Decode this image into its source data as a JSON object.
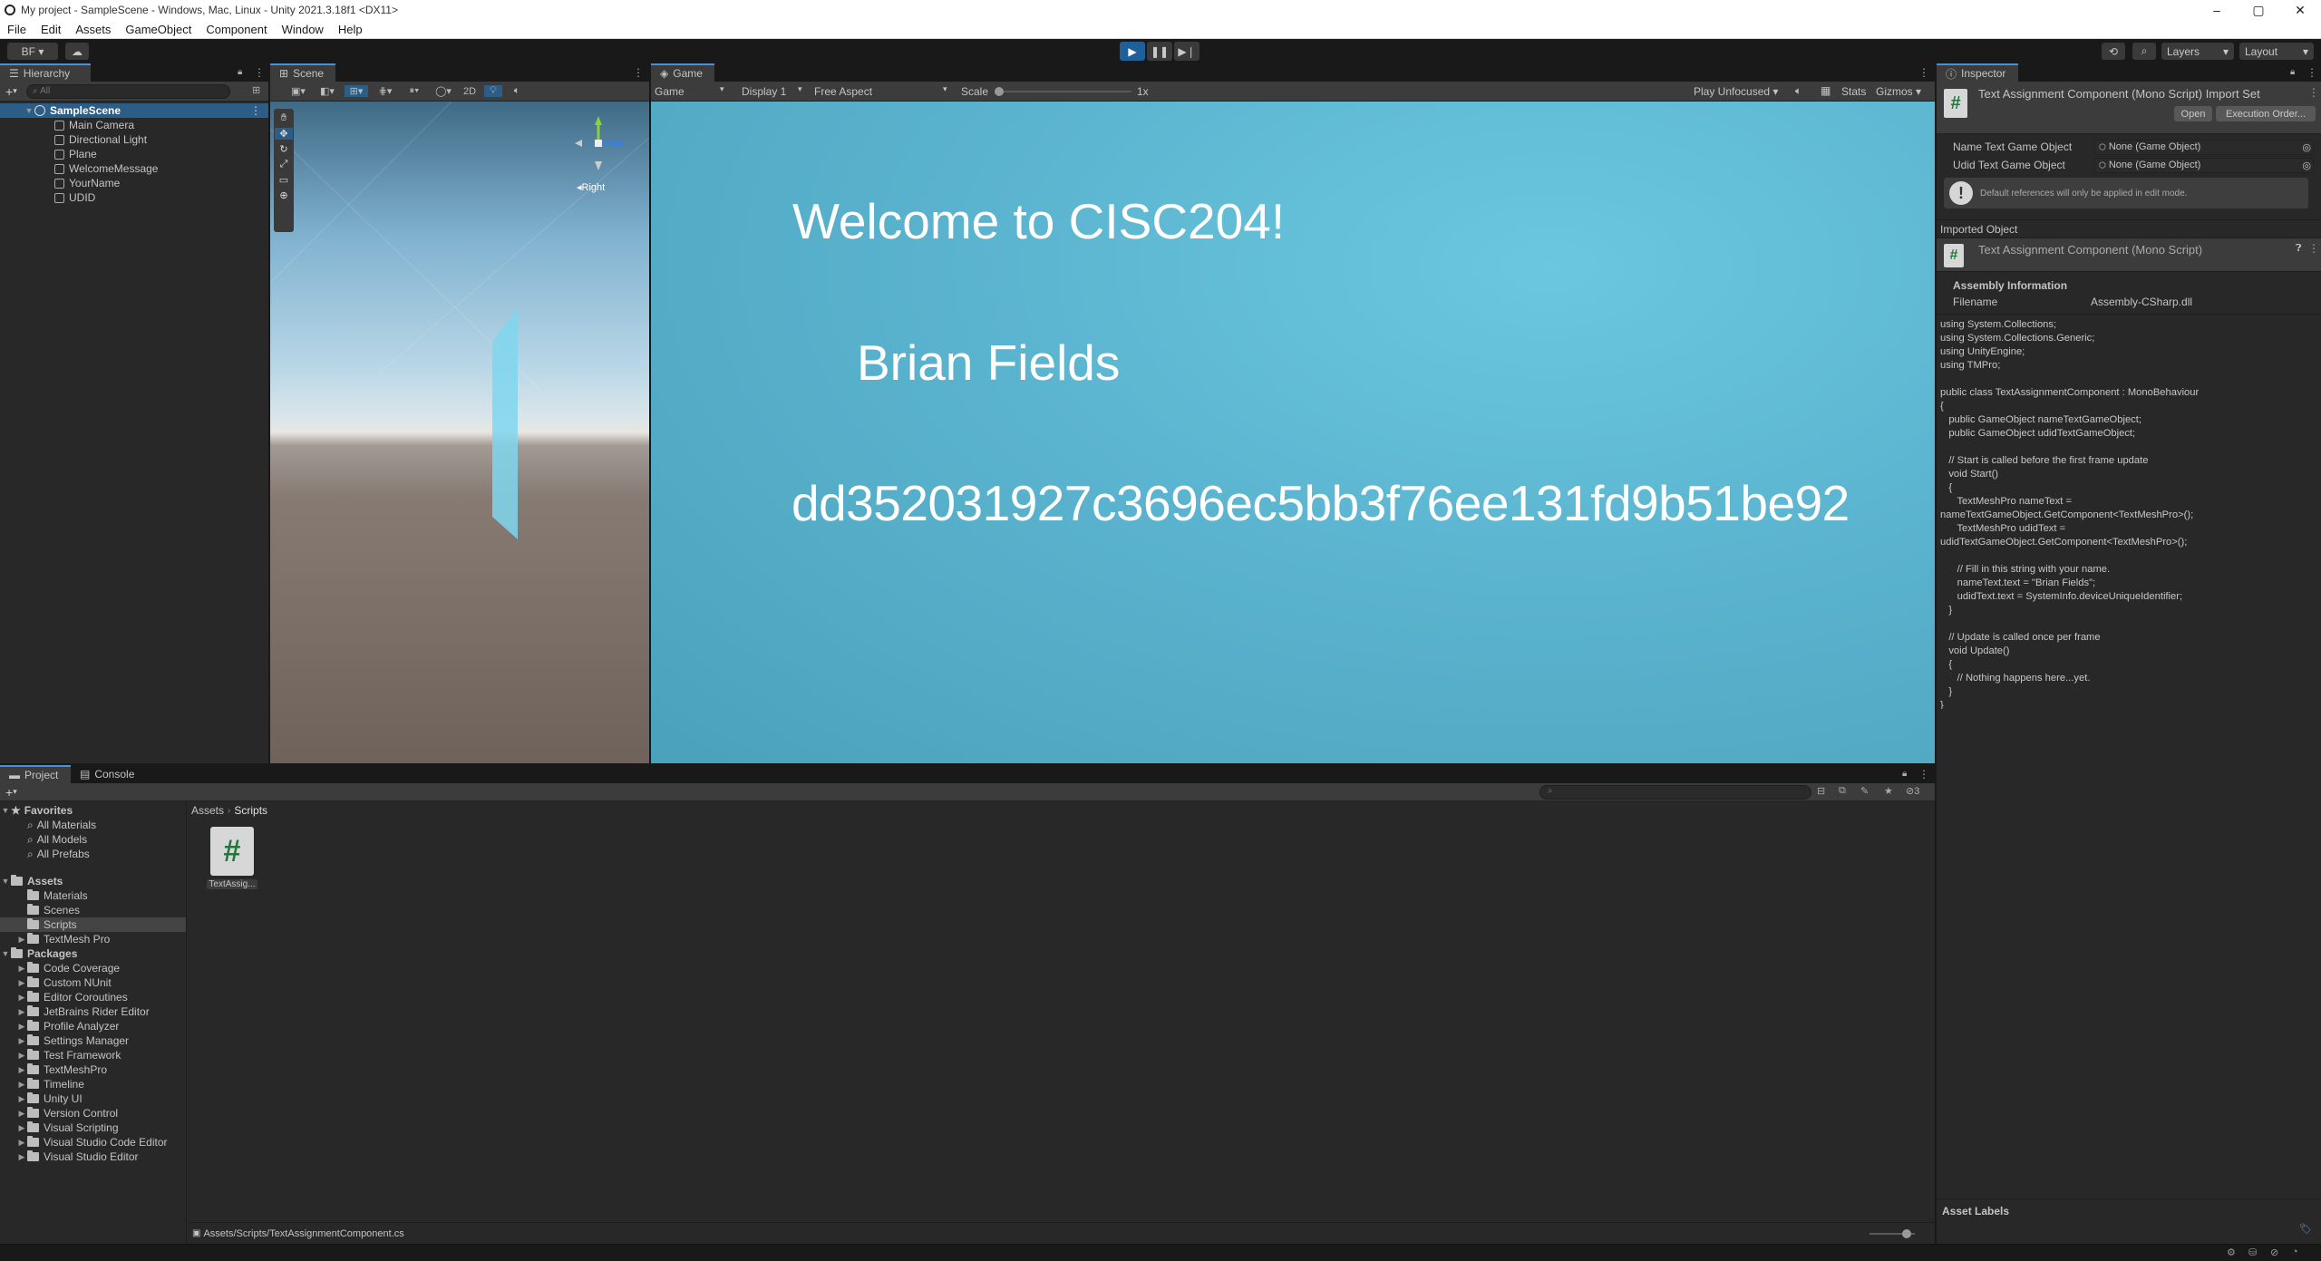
{
  "window": {
    "title": "My project - SampleScene - Windows, Mac, Linux - Unity 2021.3.18f1 <DX11>"
  },
  "menu": [
    "File",
    "Edit",
    "Assets",
    "GameObject",
    "Component",
    "Window",
    "Help"
  ],
  "toolbar": {
    "account": "BF",
    "layers": "Layers",
    "layout": "Layout"
  },
  "hierarchy": {
    "tab": "Hierarchy",
    "search_placeholder": "All",
    "scene": "SampleScene",
    "items": [
      "Main Camera",
      "Directional Light",
      "Plane",
      "WelcomeMessage",
      "YourName",
      "UDID"
    ]
  },
  "scene": {
    "tab": "Scene",
    "mode_2d": "2D",
    "gizmo_label": "Right"
  },
  "game": {
    "tab": "Game",
    "view": "Game",
    "display": "Display 1",
    "aspect": "Free Aspect",
    "scale_label": "Scale",
    "scale_value": "1x",
    "play_mode": "Play Unfocused",
    "stats": "Stats",
    "gizmos": "Gizmos",
    "welcome": "Welcome to CISC204!",
    "name": "Brian Fields",
    "udid": "dd352031927c3696ec5bb3f76ee131fd9b51be92",
    "bg_color": "#5bb4cf"
  },
  "inspector": {
    "tab": "Inspector",
    "header_title": "Text Assignment Component (Mono Script) Import Set",
    "open_button": "Open",
    "exec_order_button": "Execution Order...",
    "fields": [
      {
        "label": "Name Text Game Object",
        "value": "None (Game Object)"
      },
      {
        "label": "Udid Text Game Object",
        "value": "None (Game Object)"
      }
    ],
    "note": "Default references will only be applied in edit mode.",
    "imported_object": "Imported Object",
    "imported_title": "Text Assignment Component (Mono Script)",
    "assembly_info": "Assembly Information",
    "filename_label": "Filename",
    "filename_value": "Assembly-CSharp.dll",
    "code": [
      "using System.Collections;",
      "using System.Collections.Generic;",
      "using UnityEngine;",
      "using TMPro;",
      "",
      "public class TextAssignmentComponent : MonoBehaviour",
      "{",
      "   public GameObject nameTextGameObject;",
      "   public GameObject udidTextGameObject;",
      "",
      "   // Start is called before the first frame update",
      "   void Start()",
      "   {",
      "      TextMeshPro nameText =",
      "nameTextGameObject.GetComponent<TextMeshPro>();",
      "      TextMeshPro udidText =",
      "udidTextGameObject.GetComponent<TextMeshPro>();",
      "",
      "      // Fill in this string with your name.",
      "      nameText.text = \"Brian Fields\";",
      "      udidText.text = SystemInfo.deviceUniqueIdentifier;",
      "   }",
      "",
      "   // Update is called once per frame",
      "   void Update()",
      "   {",
      "      // Nothing happens here...yet.",
      "   }",
      "}"
    ],
    "asset_labels": "Asset Labels"
  },
  "project": {
    "tab_project": "Project",
    "tab_console": "Console",
    "breadcrumb": [
      "Assets",
      "Scripts"
    ],
    "favorites_label": "Favorites",
    "favorites": [
      "All Materials",
      "All Models",
      "All Prefabs"
    ],
    "assets_label": "Assets",
    "assets": [
      "Materials",
      "Scenes",
      "Scripts",
      "TextMesh Pro"
    ],
    "packages_label": "Packages",
    "packages": [
      "Code Coverage",
      "Custom NUnit",
      "Editor Coroutines",
      "JetBrains Rider Editor",
      "Profile Analyzer",
      "Settings Manager",
      "Test Framework",
      "TextMeshPro",
      "Timeline",
      "Unity UI",
      "Version Control",
      "Visual Scripting",
      "Visual Studio Code Editor",
      "Visual Studio Editor"
    ],
    "file_label": "TextAssig...",
    "hidden_count": "3",
    "status_path": "Assets/Scripts/TextAssignmentComponent.cs"
  }
}
